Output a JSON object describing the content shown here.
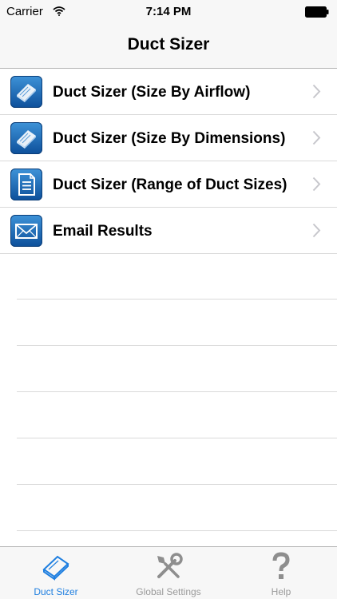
{
  "status_bar": {
    "carrier": "Carrier",
    "time": "7:14 PM"
  },
  "nav": {
    "title": "Duct Sizer"
  },
  "menu": [
    {
      "label": "Duct Sizer (Size By Airflow)",
      "icon": "duct-book-icon"
    },
    {
      "label": "Duct Sizer (Size By Dimensions)",
      "icon": "duct-book-icon"
    },
    {
      "label": "Duct Sizer (Range of Duct Sizes)",
      "icon": "document-icon"
    },
    {
      "label": "Email Results",
      "icon": "envelope-icon"
    }
  ],
  "tabs": [
    {
      "label": "Duct Sizer",
      "icon": "duct-book-icon",
      "active": true
    },
    {
      "label": "Global Settings",
      "icon": "wrench-screwdriver-icon",
      "active": false
    },
    {
      "label": "Help",
      "icon": "question-mark-icon",
      "active": false
    }
  ],
  "colors": {
    "accent": "#1f7fe0",
    "icon_blue": "#0d4f9a",
    "bar_bg": "#f7f7f7"
  }
}
